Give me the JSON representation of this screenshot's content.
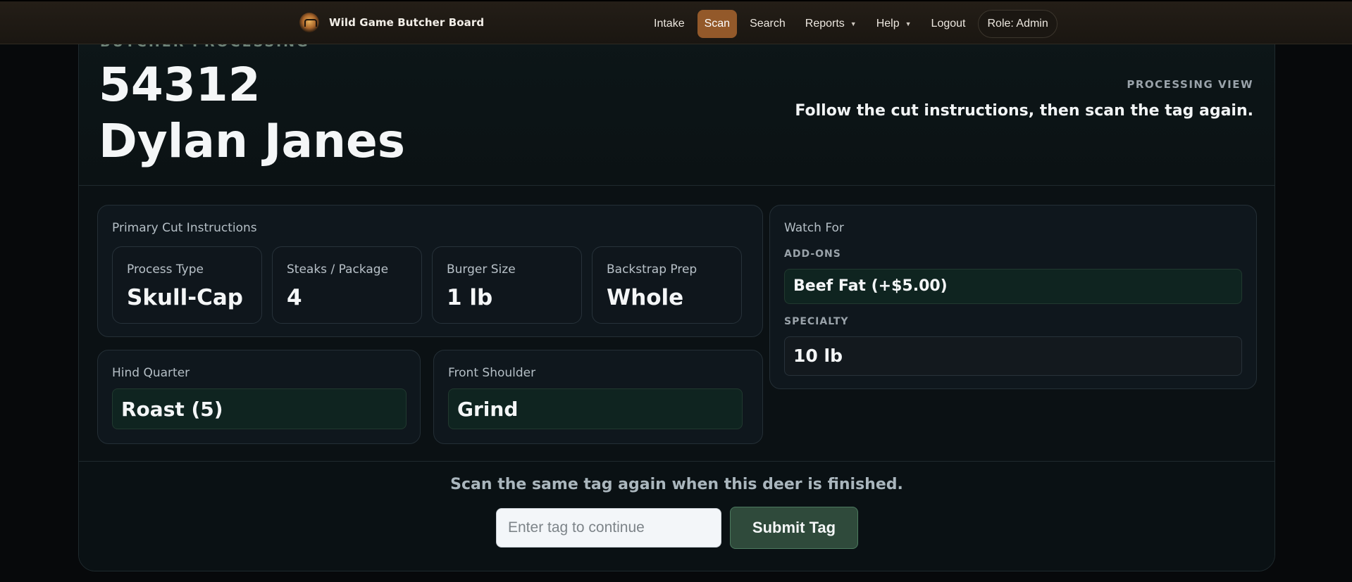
{
  "nav": {
    "brand_name": "Wild Game Butcher Board",
    "links": [
      {
        "label": "Intake"
      },
      {
        "label": "Scan"
      },
      {
        "label": "Search"
      },
      {
        "label": "Reports"
      },
      {
        "label": "Help"
      },
      {
        "label": "Logout"
      }
    ],
    "role": "Role: Admin"
  },
  "header": {
    "eyebrow": "BUTCHER PROCESSING",
    "tag_number": "54312",
    "customer_name": "Dylan Janes",
    "view_label": "PROCESSING VIEW",
    "view_instruction": "Follow the cut instructions, then scan the tag again."
  },
  "primary_cut": {
    "title": "Primary Cut Instructions",
    "stats": [
      {
        "label": "Process Type",
        "value": "Skull-Cap"
      },
      {
        "label": "Steaks / Package",
        "value": "4"
      },
      {
        "label": "Burger Size",
        "value": "1 lb"
      },
      {
        "label": "Backstrap Prep",
        "value": "Whole"
      }
    ]
  },
  "hind_quarter": {
    "title": "Hind Quarter",
    "value": "Roast (5)"
  },
  "front_shoulder": {
    "title": "Front Shoulder",
    "value": "Grind"
  },
  "watch_for": {
    "title": "Watch For",
    "addons_label": "ADD-ONS",
    "addon_value": "Beef Fat (+$5.00)",
    "specialty_label": "SPECIALTY",
    "specialty_value": "10 lb"
  },
  "footer": {
    "instruction": "Scan the same tag again when this deer is finished.",
    "input_placeholder": "Enter tag to continue",
    "input_value": "",
    "submit_label": "Submit Tag"
  },
  "colors": {
    "accent": "#93592a",
    "submit": "#2f4a3b",
    "value_highlight": "#0f2420"
  }
}
